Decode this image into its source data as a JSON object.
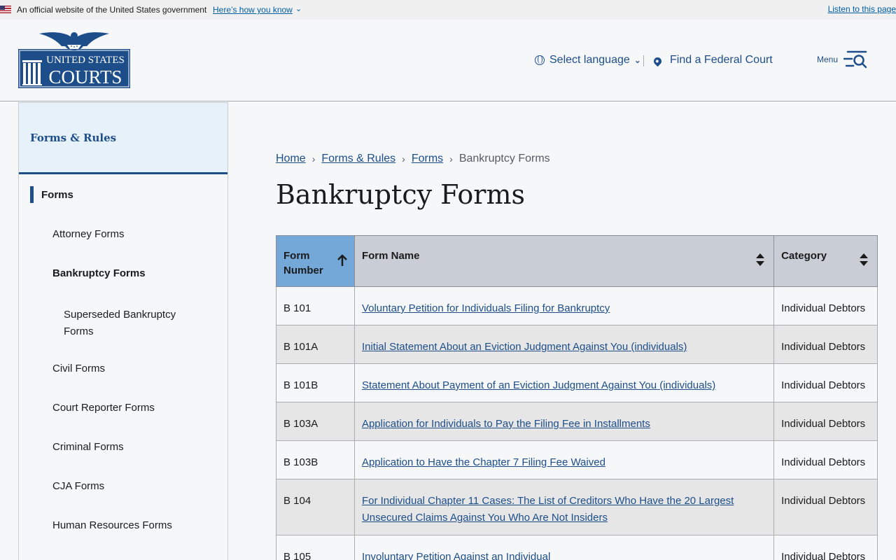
{
  "gov_banner": {
    "text": "An official website of the United States government",
    "link": "Here’s how you know",
    "listen": "Listen to this page"
  },
  "header": {
    "logo_text_top": "UNITED STATES",
    "logo_text_bottom": "COURTS",
    "language": "Select language",
    "find_court": "Find a Federal Court",
    "menu": "Menu"
  },
  "sidebar": {
    "title": "Forms & Rules",
    "items": [
      {
        "label": "Forms"
      },
      {
        "label": "Attorney Forms"
      },
      {
        "label": "Bankruptcy Forms"
      },
      {
        "label": "Superseded Bankruptcy Forms"
      },
      {
        "label": "Civil Forms"
      },
      {
        "label": "Court Reporter Forms"
      },
      {
        "label": "Criminal Forms"
      },
      {
        "label": "CJA Forms"
      },
      {
        "label": "Human Resources Forms"
      }
    ]
  },
  "breadcrumb": [
    "Home",
    "Forms & Rules",
    "Forms",
    "Bankruptcy Forms"
  ],
  "page_title": "Bankruptcy Forms",
  "table": {
    "headers": [
      "Form Number",
      "Form Name",
      "Category"
    ],
    "rows": [
      {
        "number": "B 101",
        "name": "Voluntary Petition for Individuals Filing for Bankruptcy",
        "category": "Individual Debtors"
      },
      {
        "number": "B 101A",
        "name": "Initial Statement About an Eviction Judgment Against You (individuals)",
        "category": "Individual Debtors"
      },
      {
        "number": "B 101B",
        "name": "Statement About Payment of an Eviction Judgment Against You (individuals)",
        "category": "Individual Debtors"
      },
      {
        "number": "B 103A",
        "name": "Application for Individuals to Pay the Filing Fee in Installments",
        "category": "Individual Debtors"
      },
      {
        "number": "B 103B",
        "name": "Application to Have the Chapter 7 Filing Fee Waived",
        "category": "Individual Debtors"
      },
      {
        "number": "B 104",
        "name": "For Individual Chapter 11 Cases: The List of Creditors Who Have the 20 Largest Unsecured Claims Against You Who Are Not Insiders",
        "category": "Individual Debtors"
      },
      {
        "number": "B 105",
        "name": "Involuntary Petition Against an Individual",
        "category": "Individual Debtors"
      }
    ]
  },
  "colors": {
    "brand": "#1d4e89",
    "link": "#005ea2",
    "sorted_header": "#73a8d8",
    "header": "#c9cdd6"
  }
}
